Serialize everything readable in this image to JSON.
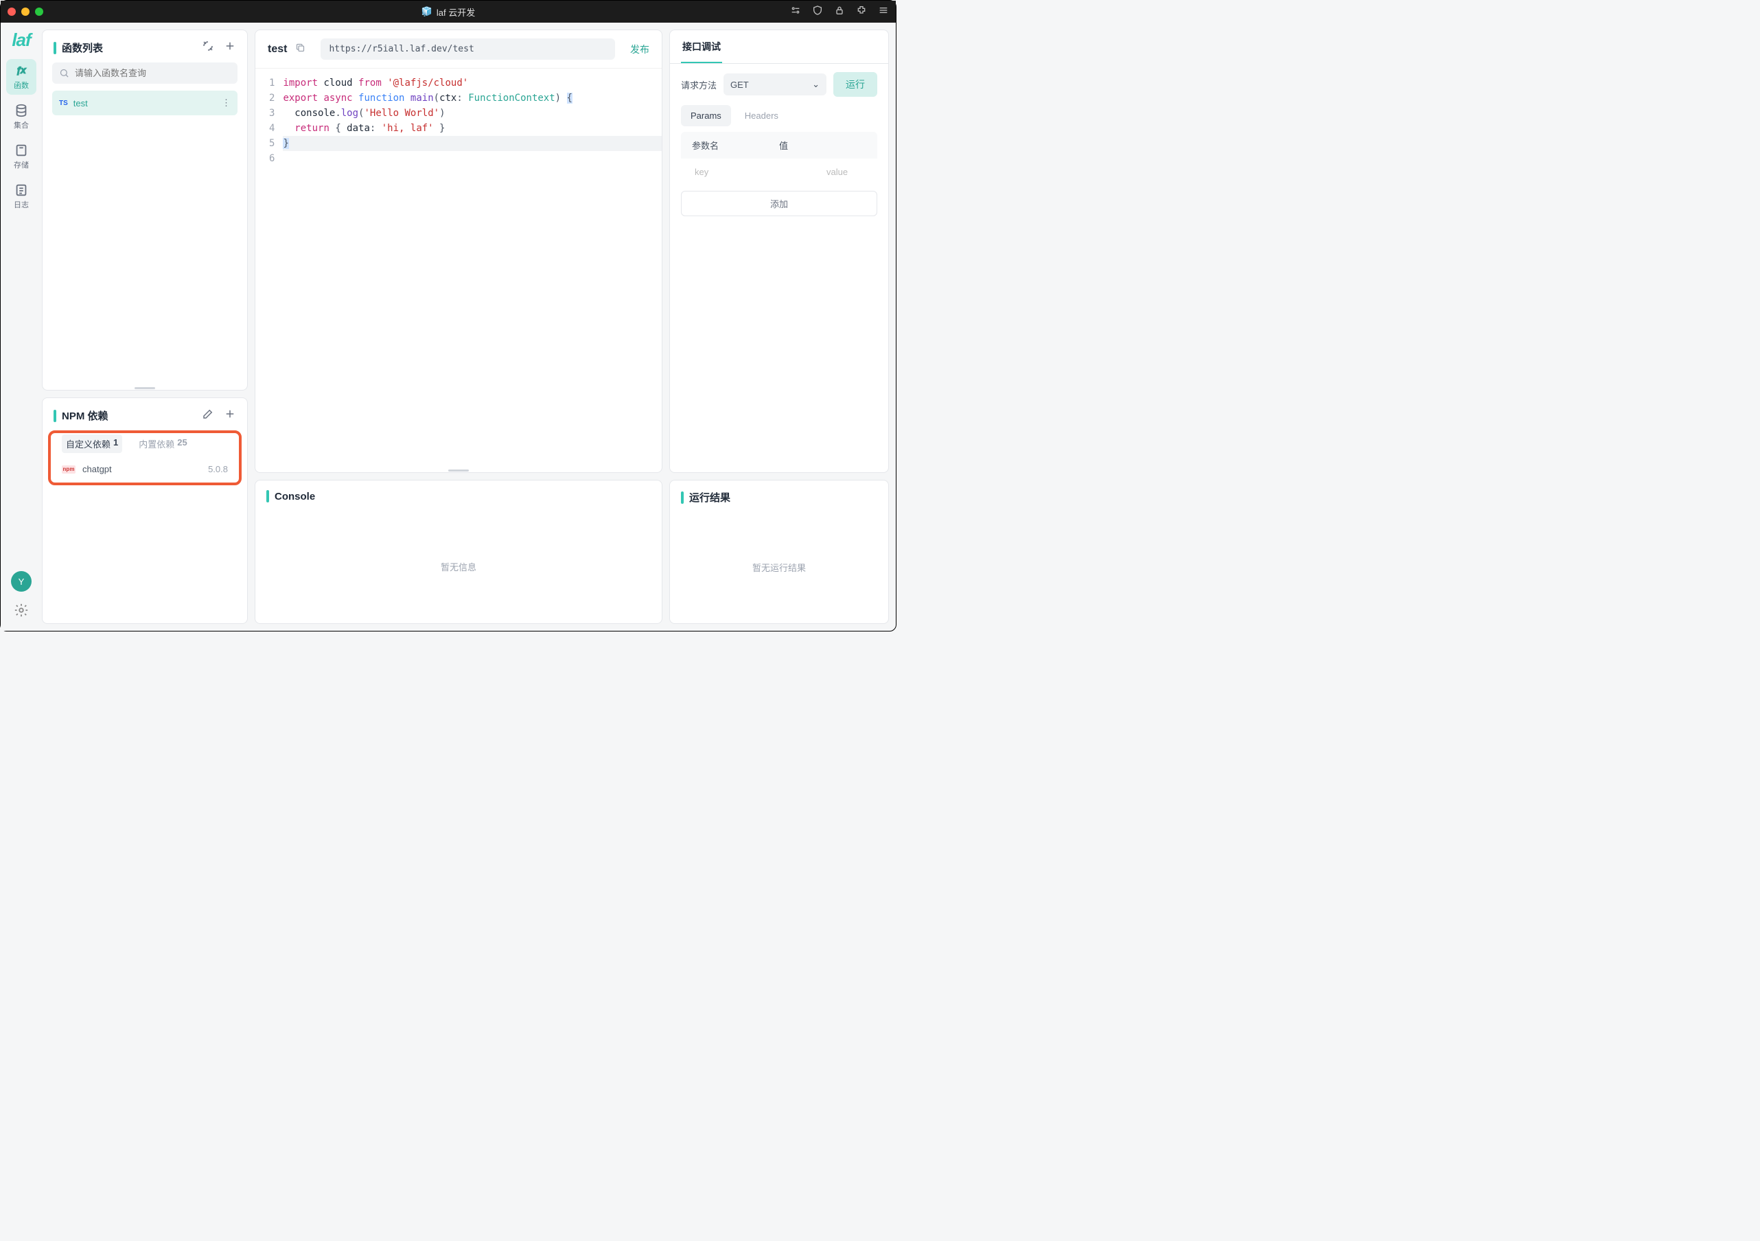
{
  "titlebar": {
    "title": "laf 云开发"
  },
  "rail": {
    "logo": "laf",
    "items": [
      {
        "label": "函数"
      },
      {
        "label": "集合"
      },
      {
        "label": "存储"
      },
      {
        "label": "日志"
      }
    ],
    "avatar": "Y"
  },
  "functions": {
    "title": "函数列表",
    "search_placeholder": "请输入函数名查询",
    "items": [
      {
        "badge": "TS",
        "name": "test"
      }
    ]
  },
  "npm": {
    "title": "NPM 依赖",
    "tabs": {
      "custom_label": "自定义依赖",
      "custom_count": "1",
      "builtin_label": "内置依赖",
      "builtin_count": "25"
    },
    "deps": [
      {
        "name": "chatgpt",
        "version": "5.0.8"
      }
    ]
  },
  "editor": {
    "fn_name": "test",
    "url": "https://r5iall.laf.dev/test",
    "publish": "发布",
    "code": {
      "lines": [
        {
          "n": "1",
          "tokens": [
            [
              "kw",
              "import"
            ],
            [
              " "
            ],
            [
              "id",
              "cloud"
            ],
            [
              " "
            ],
            [
              "kw",
              "from"
            ],
            [
              " "
            ],
            [
              "str",
              "'@lafjs/cloud'"
            ]
          ]
        },
        {
          "n": "2",
          "tokens": []
        },
        {
          "n": "3",
          "tokens": [
            [
              "kw",
              "export"
            ],
            [
              " "
            ],
            [
              "kw",
              "async"
            ],
            [
              " "
            ],
            [
              "kw2",
              "function"
            ],
            [
              " "
            ],
            [
              "fn",
              "main"
            ],
            [
              "punc",
              "("
            ],
            [
              "id",
              "ctx"
            ],
            [
              "punc",
              ": "
            ],
            [
              "type",
              "FunctionContext"
            ],
            [
              "punc",
              ")"
            ],
            [
              " "
            ],
            [
              "brace",
              "{"
            ]
          ]
        },
        {
          "n": "4",
          "tokens": [
            [
              "  "
            ],
            [
              "id",
              "console"
            ],
            [
              "punc",
              "."
            ],
            [
              "fn",
              "log"
            ],
            [
              "punc",
              "("
            ],
            [
              "str",
              "'Hello World'"
            ],
            [
              "punc",
              ")"
            ]
          ]
        },
        {
          "n": "5",
          "tokens": [
            [
              "  "
            ],
            [
              "kw",
              "return"
            ],
            [
              " "
            ],
            [
              "punc",
              "{ "
            ],
            [
              "id",
              "data"
            ],
            [
              "punc",
              ": "
            ],
            [
              "str",
              "'hi, laf'"
            ],
            [
              "punc",
              " }"
            ]
          ]
        },
        {
          "n": "6",
          "tokens": [
            [
              "brace2",
              "}"
            ]
          ],
          "hl": true
        }
      ]
    }
  },
  "debug": {
    "title": "接口调试",
    "method_label": "请求方法",
    "method_value": "GET",
    "run": "运行",
    "tabs": {
      "params": "Params",
      "headers": "Headers"
    },
    "param_head": {
      "name": "参数名",
      "value": "值"
    },
    "param_placeholder": {
      "key": "key",
      "value": "value"
    },
    "add": "添加"
  },
  "console": {
    "title": "Console",
    "empty": "暂无信息"
  },
  "result": {
    "title": "运行结果",
    "empty": "暂无运行结果"
  }
}
